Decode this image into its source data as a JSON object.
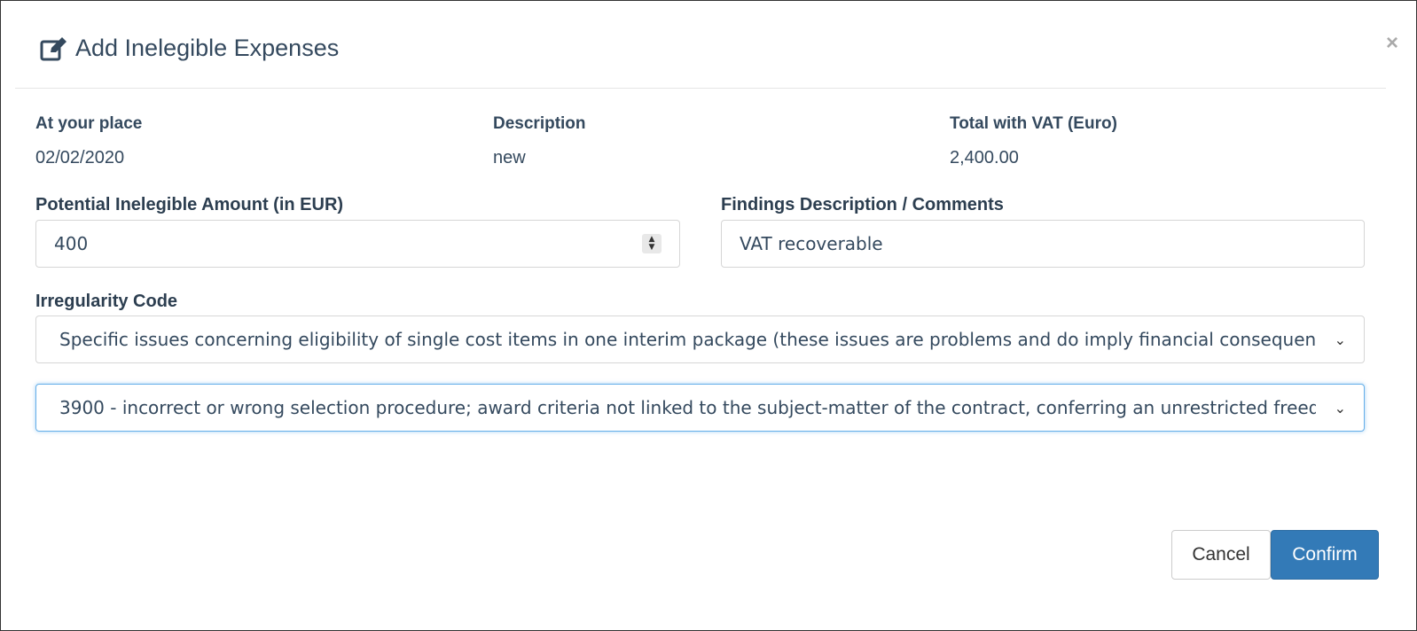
{
  "modal": {
    "title": "Add Inelegible Expenses",
    "close_glyph": "×",
    "title_icon": "edit-icon"
  },
  "info": {
    "at_your_place_label": "At your place",
    "at_your_place_value": "02/02/2020",
    "description_label": "Description",
    "description_value": "new",
    "total_label": "Total with VAT (Euro)",
    "total_value": "2,400.00"
  },
  "form": {
    "amount_label": "Potential Inelegible Amount (in EUR)",
    "amount_value": "400",
    "findings_label": "Findings Description / Comments",
    "findings_value": "VAT recoverable",
    "irregularity_label": "Irregularity Code",
    "irregularity_category_value": "Specific issues concerning eligibility of single cost items in one interim package (these issues are problems and do imply financial consequences)",
    "irregularity_code_value": "3900 - incorrect or wrong selection procedure; award criteria not linked to the subject-matter of the contract, conferring an unrestricted freedom of choice"
  },
  "buttons": {
    "cancel": "Cancel",
    "confirm": "Confirm"
  },
  "colors": {
    "primary": "#337ab7",
    "text": "#34495e",
    "focus_border": "#66afe9"
  }
}
